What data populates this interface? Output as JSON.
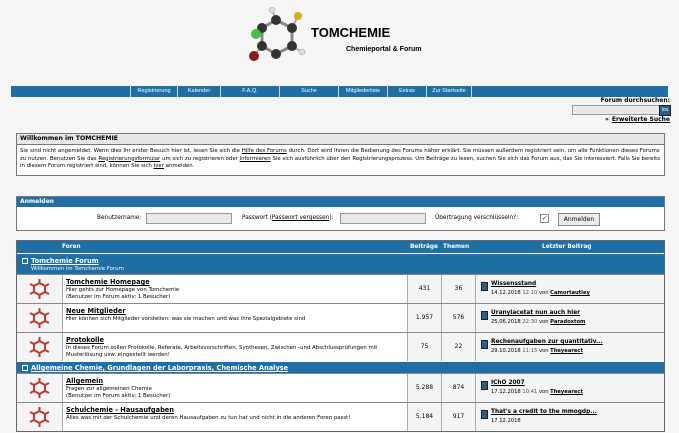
{
  "header": {
    "site_title": "TOMCHEMIE",
    "site_subtitle": "Chemieportal & Forum"
  },
  "nav": {
    "items": [
      "Registrierung",
      "Kalender",
      "F.A.Q.",
      "Suche",
      "Mitgliederliste",
      "Extras",
      "Zur Startseite"
    ]
  },
  "search": {
    "label": "Forum durchsuchen:",
    "button_label": "los",
    "advanced_link": "Erweiterte Suche",
    "advanced_arrow": "»"
  },
  "welcome": {
    "title": "Willkommen im TOMCHEMIE",
    "text_1": "Sie sind nicht angemeldet. Wenn dies Ihr erster Besuch hier ist, lesen Sie sich die ",
    "link_help": "Hilfe des Forums",
    "text_2": " durch. Dort wird Ihnen die Bedienung des Forums näher erklärt. Sie müssen außerdem registriert sein, um alle Funktionen dieses Forums zu nutzen. Benutzen Sie das ",
    "link_register": "Registrierungsformular",
    "text_3": " um sich zu registrieren oder ",
    "link_inform": "informieren",
    "text_4": " Sie sich ausführlich über den Registrierungsprozess. Um Beiträge zu lesen, suchen Sie sich das Forum aus, das Sie interessiert. Falls Sie bereits in diesem Forum registriert sind, können Sie sich ",
    "link_here": "hier",
    "text_5": " anmelden."
  },
  "login": {
    "title": "Anmelden",
    "username_label": "Benutzername:",
    "password_label": "Passwort (",
    "password_forgot": "Passwort vergessen",
    "password_label_end": "):",
    "encrypt_label": "Übertragung verschlüsseln?:",
    "check_mark": "✓",
    "submit_label": "Anmelden"
  },
  "table": {
    "headers": {
      "forum": "Foren",
      "posts": "Beiträge",
      "topics": "Themen",
      "last": "Letzter Beitrag"
    },
    "category_1": {
      "title": "Tomchemie Forum",
      "subtitle": "Willkommen im Tomchemie Forum"
    },
    "category_2": {
      "title": "Allgemeine Chemie, Grundlagen der Laborpraxis, Chemische Analyse"
    },
    "forums": [
      {
        "name": "Tomchemie Homepage",
        "desc": "Hier gehts zur Homepage von Tomchemie",
        "desc2": "(Benutzer im Forum aktiv: 1 Besucher)",
        "posts": "431",
        "topics": "36",
        "last_title": "Wissensstand",
        "last_date": "14.12.2018",
        "last_time": "12:10",
        "last_von": "von",
        "last_user": "Camortautley"
      },
      {
        "name": "Neue Mitglieder",
        "desc": "Hier können sich Mitglieder vorstellen: was sie machen und was ihre Spezialgebiete sind",
        "desc2": "",
        "posts": "1.957",
        "topics": "576",
        "last_title": "Uranylacetat nun auch hier",
        "last_date": "25.06.2018",
        "last_time": "22:30",
        "last_von": "von",
        "last_user": "Paradoxtom"
      },
      {
        "name": "Protokolle",
        "desc": "In dieses Forum sollen Protokolle, Referate, Arbeitsvorschriften, Synthesen, Zwischen -und Abschlussprüfungen mit Musterlösung usw. eingestellt werden!",
        "desc2": "",
        "posts": "75",
        "topics": "22",
        "last_title": "Rechenaufgaben zur quantitativ...",
        "last_date": "29.10.2018",
        "last_time": "11:15",
        "last_von": "von",
        "last_user": "Theyearect"
      },
      {
        "name": "Allgemein",
        "desc": "Fragen zur allgemeinen Chemie",
        "desc2": "(Benutzer im Forum aktiv: 1 Besucher)",
        "posts": "5.288",
        "topics": "874",
        "last_title": "IChO 2007",
        "last_date": "17.12.2018",
        "last_time": "10:41",
        "last_von": "von",
        "last_user": "Theyearect"
      },
      {
        "name": "Schulchemie - Hausaufgaben",
        "desc": "Alles was mit der Schulchemie und deren Hausaufgaben zu tun hat und nicht in die anderen Foren passt!",
        "desc2": "",
        "posts": "5.184",
        "topics": "917",
        "last_title": "That's a credit to the mmogdp...",
        "last_date": "17.12.2018",
        "last_time": "",
        "last_von": "",
        "last_user": ""
      }
    ]
  },
  "colors": {
    "accent": "#1d6fa5",
    "icon_red": "#c0392b"
  }
}
